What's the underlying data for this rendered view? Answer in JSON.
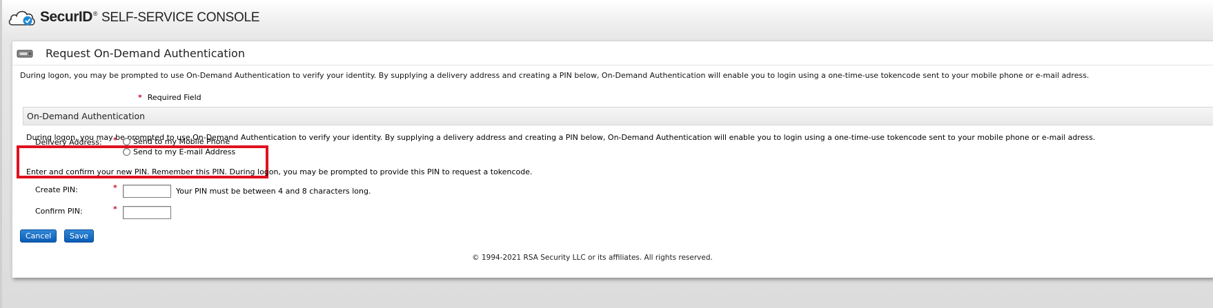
{
  "header": {
    "brand": "SecurID",
    "brand_tm": "®",
    "console": "SELF-SERVICE CONSOLE"
  },
  "panel": {
    "title": "Request On-Demand Authentication",
    "intro": "During logon, you may be prompted to use On-Demand Authentication to verify your identity. By supplying a delivery address and creating a PIN below, On-Demand Authentication will enable you to login using a one-time-use tokencode sent to your mobile phone or e-mail adress.",
    "required_marker": "*",
    "required_label": "Required Field"
  },
  "section": {
    "title": "On-Demand Authentication",
    "description": "During logon, you may be prompted to use On-Demand Authentication to verify your identity. By supplying a delivery address and creating a PIN below, On-Demand Authentication will enable you to login using a one-time-use tokencode sent to your mobile phone or e-mail adress."
  },
  "delivery": {
    "label": "Delivery Address:",
    "options": [
      "Send to my Mobile Phone",
      "Send to my E-mail Address"
    ]
  },
  "pin": {
    "info": "Enter and confirm your new PIN. Remember this PIN. During logon, you may be prompted to provide this PIN to request a tokencode.",
    "create_label": "Create PIN:",
    "create_value": "",
    "create_hint": "Your PIN must be between 4 and 8 characters long.",
    "confirm_label": "Confirm PIN:",
    "confirm_value": ""
  },
  "buttons": {
    "cancel": "Cancel",
    "save": "Save"
  },
  "footer": "© 1994-2021 RSA Security LLC or its affiliates. All rights reserved.",
  "colors": {
    "required_star": "#c8102e",
    "highlight_border": "#e0101d",
    "button_bg": "#0a5cb5",
    "brand_check": "#1f8ad4"
  }
}
